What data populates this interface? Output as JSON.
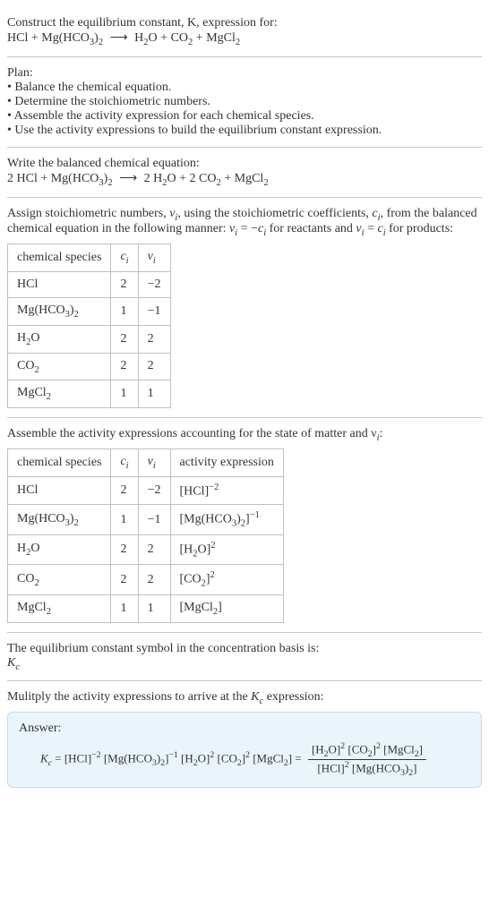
{
  "intro": {
    "line1": "Construct the equilibrium constant, K, expression for:",
    "equation_lhs1": "HCl",
    "equation_lhs2": "Mg(HCO",
    "equation_lhs2_sub1": "3",
    "equation_lhs2_close": ")",
    "equation_lhs2_sub2": "2",
    "equation_rhs1": "H",
    "equation_rhs1_sub": "2",
    "equation_rhs1_suffix": "O",
    "equation_rhs2": "CO",
    "equation_rhs2_sub": "2",
    "equation_rhs3": "MgCl",
    "equation_rhs3_sub": "2"
  },
  "plan": {
    "title": "Plan:",
    "items": [
      "Balance the chemical equation.",
      "Determine the stoichiometric numbers.",
      "Assemble the activity expression for each chemical species.",
      "Use the activity expressions to build the equilibrium constant expression."
    ]
  },
  "balanced": {
    "title": "Write the balanced chemical equation:",
    "c1": "2",
    "c2": "2",
    "c3": "2"
  },
  "assign": {
    "text_before": "Assign stoichiometric numbers, ",
    "nu": "ν",
    "sub_i": "i",
    "text_mid1": ", using the stoichiometric coefficients, ",
    "c": "c",
    "text_mid2": ", from the balanced chemical equation in the following manner: ",
    "rel1_lhs": "ν",
    "rel1_eq": " = −",
    "rel1_rhs": "c",
    "text_mid3": " for reactants and ",
    "rel2_eq": " = ",
    "text_after": " for products:"
  },
  "stoich_table": {
    "headers": [
      "chemical species",
      "c",
      "ν"
    ],
    "rows": [
      {
        "species": "HCl",
        "c": "2",
        "nu": "−2"
      },
      {
        "species": "Mg(HCO3)2",
        "c": "1",
        "nu": "−1"
      },
      {
        "species": "H2O",
        "c": "2",
        "nu": "2"
      },
      {
        "species": "CO2",
        "c": "2",
        "nu": "2"
      },
      {
        "species": "MgCl2",
        "c": "1",
        "nu": "1"
      }
    ]
  },
  "activity_intro": "Assemble the activity expressions accounting for the state of matter and ν",
  "activity_intro_sub": "i",
  "activity_intro_colon": ":",
  "activity_table": {
    "headers": [
      "chemical species",
      "c",
      "ν",
      "activity expression"
    ],
    "rows": [
      {
        "species": "HCl",
        "c": "2",
        "nu": "−2",
        "expr_base": "[HCl]",
        "expr_exp": "−2"
      },
      {
        "species": "Mg(HCO3)2",
        "c": "1",
        "nu": "−1",
        "expr_base": "[Mg(HCO3)2]",
        "expr_exp": "−1"
      },
      {
        "species": "H2O",
        "c": "2",
        "nu": "2",
        "expr_base": "[H2O]",
        "expr_exp": "2"
      },
      {
        "species": "CO2",
        "c": "2",
        "nu": "2",
        "expr_base": "[CO2]",
        "expr_exp": "2"
      },
      {
        "species": "MgCl2",
        "c": "1",
        "nu": "1",
        "expr_base": "[MgCl2]",
        "expr_exp": ""
      }
    ]
  },
  "eq_const_symbol": {
    "line1": "The equilibrium constant symbol in the concentration basis is:",
    "K": "K",
    "sub": "c"
  },
  "multiply": {
    "text1": "Mulitply the activity expressions to arrive at the ",
    "K": "K",
    "sub": "c",
    "text2": " expression:"
  },
  "answer": {
    "label": "Answer:",
    "Kc_K": "K",
    "Kc_sub": "c",
    "eq": " = ",
    "t1": "[HCl]",
    "e1": "−2",
    "t2": " [Mg(HCO",
    "t2sub1": "3",
    "t2mid": ")",
    "t2sub2": "2",
    "t2close": "]",
    "e2": "−1",
    "t3": " [H",
    "t3sub": "2",
    "t3suf": "O]",
    "e3": "2",
    "t4": " [CO",
    "t4sub": "2",
    "t4close": "]",
    "e4": "2",
    "t5": " [MgCl",
    "t5sub": "2",
    "t5close": "] = ",
    "num1": "[H",
    "num1sub": "2",
    "num1suf": "O]",
    "nume1": "2",
    "num2": " [CO",
    "num2sub": "2",
    "num2close": "]",
    "nume2": "2",
    "num3": " [MgCl",
    "num3sub": "2",
    "num3close": "]",
    "den1": "[HCl]",
    "dene1": "2",
    "den2": " [Mg(HCO",
    "den2sub1": "3",
    "den2mid": ")",
    "den2sub2": "2",
    "den2close": "]"
  }
}
